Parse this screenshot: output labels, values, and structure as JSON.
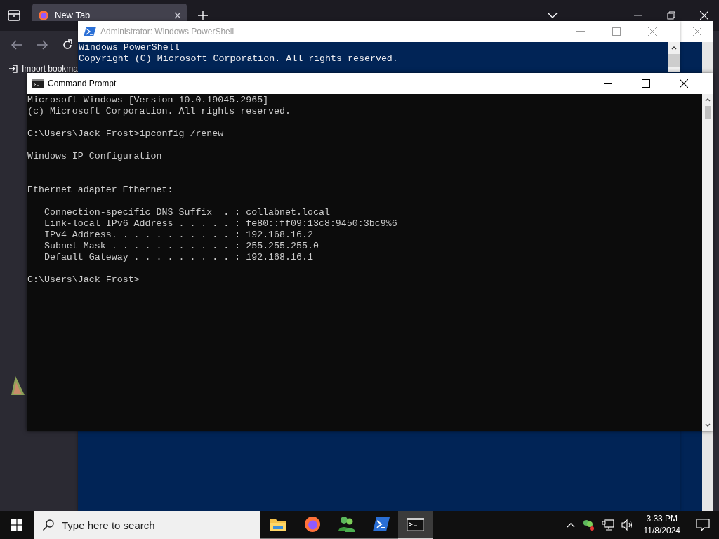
{
  "browser": {
    "tab": {
      "label": "New Tab",
      "selected": true
    },
    "bookmark": "Import bookma"
  },
  "powershell": {
    "title": "Administrator: Windows PowerShell",
    "active": false,
    "lines": [
      "Windows PowerShell",
      "Copyright (C) Microsoft Corporation. All rights reserved."
    ]
  },
  "cmd": {
    "title": "Command Prompt",
    "active": true,
    "blocks": [
      {
        "lines": [
          "Microsoft Windows [Version 10.0.19045.2965]",
          "(c) Microsoft Corporation. All rights reserved."
        ]
      },
      {
        "lines": [
          "C:\\Users\\Jack Frost>ipconfig /renew"
        ]
      },
      {
        "lines": [
          "Windows IP Configuration"
        ]
      },
      {
        "lines": [
          "Ethernet adapter Ethernet:"
        ]
      },
      {
        "lines": [
          "   Connection-specific DNS Suffix  . : collabnet.local",
          "   Link-local IPv6 Address . . . . . : fe80::ff09:13c8:9450:3bc9%6",
          "   IPv4 Address. . . . . . . . . . . : 192.168.16.2",
          "   Subnet Mask . . . . . . . . . . . : 255.255.255.0",
          "   Default Gateway . . . . . . . . . : 192.168.16.1"
        ]
      },
      {
        "lines": [
          "C:\\Users\\Jack Frost>"
        ]
      }
    ]
  },
  "taskbar": {
    "search": {
      "placeholder": "Type here to search"
    },
    "apps": [
      {
        "kind": "folder",
        "selected": false
      },
      {
        "kind": "firefox",
        "selected": false
      },
      {
        "kind": "people",
        "selected": false
      },
      {
        "kind": "powershell",
        "selected": false
      },
      {
        "kind": "terminal",
        "selected": true
      }
    ],
    "time": "3:33 PM",
    "date": "11/8/2024"
  }
}
